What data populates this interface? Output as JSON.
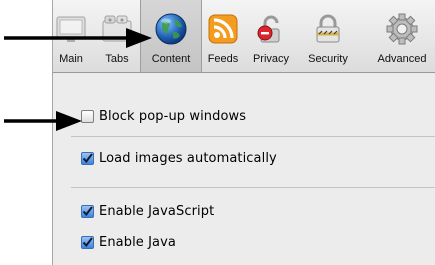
{
  "toolbar": {
    "items": [
      {
        "label": "Main",
        "icon": "main-icon"
      },
      {
        "label": "Tabs",
        "icon": "tabs-icon"
      },
      {
        "label": "Content",
        "icon": "globe-icon",
        "selected": true
      },
      {
        "label": "Feeds",
        "icon": "rss-feed-icon"
      },
      {
        "label": "Privacy",
        "icon": "privacy-icon"
      },
      {
        "label": "Security",
        "icon": "lock-icon"
      },
      {
        "label": "Advanced",
        "icon": "gear-icon"
      }
    ]
  },
  "options": {
    "block_popups": {
      "label": "Block pop-up windows",
      "checked": false
    },
    "load_images": {
      "label": "Load images automatically",
      "checked": true
    },
    "enable_javascript": {
      "label": "Enable JavaScript",
      "checked": true
    },
    "enable_java": {
      "label": "Enable Java",
      "checked": true
    }
  },
  "colors": {
    "accent": "#3d83df",
    "arrow": "#000000"
  }
}
